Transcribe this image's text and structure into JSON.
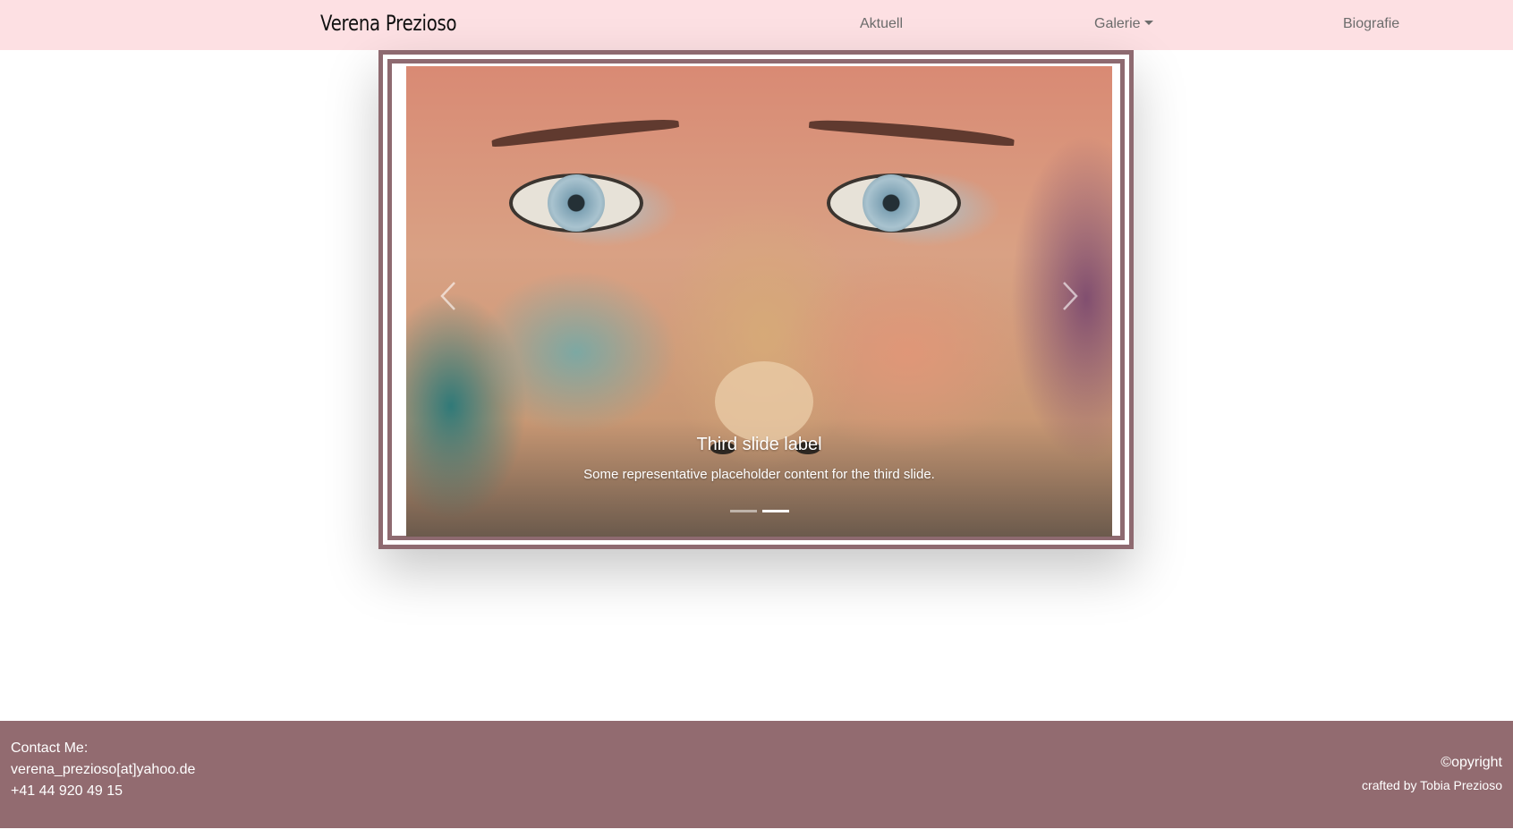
{
  "nav": {
    "brand": "Verena Prezioso",
    "links": [
      "Aktuell",
      "Galerie",
      "Biografie"
    ]
  },
  "carousel": {
    "active_index": 1,
    "slide_count": 2,
    "caption_title": "Third slide label",
    "caption_text": "Some representative placeholder content for the third slide.",
    "prev_icon": "chevron-left-icon",
    "next_icon": "chevron-right-icon"
  },
  "footer": {
    "contact_label": "Contact Me:",
    "email": "verena_prezioso[at]yahoo.de",
    "phone": "+41 44 920 49 15",
    "copyright": "©opyright",
    "credit": "crafted by Tobia Prezioso"
  },
  "colors": {
    "navbar_bg": "#fde0e3",
    "frame_border": "#8e6a70",
    "footer_bg": "#926b70"
  }
}
